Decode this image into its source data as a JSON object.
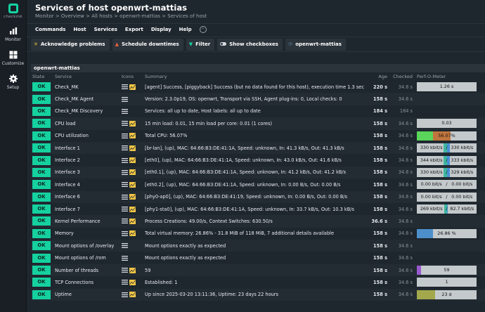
{
  "app": {
    "logo_text": "checkmk"
  },
  "sidebar": {
    "items": [
      {
        "label": "Monitor",
        "icon": "monitor-icon"
      },
      {
        "label": "Customize",
        "icon": "customize-icon"
      },
      {
        "label": "Setup",
        "icon": "setup-icon"
      }
    ]
  },
  "header": {
    "title": "Services of host openwrt-mattias",
    "breadcrumb": "Monitor > Overview > All hosts > openwrt-mattias > Services of host"
  },
  "menubar": {
    "items": [
      "Commands",
      "Host",
      "Services",
      "Export",
      "Display",
      "Help"
    ]
  },
  "toolbar": {
    "acknowledge": "Acknowledge problems",
    "downtimes": "Schedule downtimes",
    "filter": "Filter",
    "checkboxes": "Show checkboxes",
    "host": "openwrt-mattias"
  },
  "table": {
    "title": "openwrt-mattias",
    "columns": {
      "state": "State",
      "service": "Service",
      "icons": "Icons",
      "summary": "Summary",
      "age": "Age",
      "checked": "Checked",
      "perf": "Perf-O-Meter"
    },
    "rows": [
      {
        "state": "OK",
        "service": "Check_MK",
        "summary": "[agent] Success, [piggyback] Success (but no data found for this host), execution time 1.3 sec",
        "age": "220 s",
        "checked": "34.6 s",
        "graph": true,
        "perf": {
          "text": "1.26 s",
          "fill": 0
        }
      },
      {
        "state": "OK",
        "service": "Check_MK Agent",
        "summary": "Version: 2.3.0p19, OS: openwrt, Transport via SSH, Agent plug-ins: 0, Local checks: 0",
        "age": "158 s",
        "checked": "34.6 s",
        "graph": false,
        "perf": null
      },
      {
        "state": "OK",
        "service": "Check_MK Discovery",
        "summary": "Services: all up to date, Host labels: all up to date",
        "age": "184 s",
        "checked": "184 s",
        "graph": false,
        "perf": null
      },
      {
        "state": "OK",
        "service": "CPU load",
        "summary": "15 min load: 0.01, 15 min load per core: 0.01 (1 cores)",
        "age": "158 s",
        "checked": "34.6 s",
        "graph": true,
        "perf": {
          "text": "0.03",
          "fill": 0
        }
      },
      {
        "state": "OK",
        "service": "CPU utilization",
        "summary": "Total CPU: 56.07%",
        "age": "158 s",
        "checked": "34.6 s",
        "graph": true,
        "perf": {
          "text": "56.07%",
          "segments": [
            {
              "frac": 0.27,
              "color": "#5ad45a"
            },
            {
              "frac": 0.29,
              "color": "#c0753d"
            }
          ]
        }
      },
      {
        "state": "OK",
        "service": "Interface 1",
        "summary": "[br-lan], (up), MAC: 64:66:B3:DE:41:1A, Speed: unknown, In: 41.3 kB/s, Out: 41.3 kB/s",
        "age": "158 s",
        "checked": "34.6 s",
        "graph": true,
        "perf": {
          "in": "330 kbit/s",
          "out": "330 kbit/s",
          "in_frac": 0.1,
          "out_frac": 0.1
        }
      },
      {
        "state": "OK",
        "service": "Interface 2",
        "summary": "[eth0], (up), MAC: 64:66:B3:DE:41:1A, Speed: unknown, In: 43.0 kB/s, Out: 41.6 kB/s",
        "age": "158 s",
        "checked": "34.6 s",
        "graph": true,
        "perf": {
          "in": "344 kbit/s",
          "out": "333 kbit/s",
          "in_frac": 0.1,
          "out_frac": 0.1
        }
      },
      {
        "state": "OK",
        "service": "Interface 3",
        "summary": "[eth0.1], (up), MAC: 64:66:B3:DE:41:1A, Speed: unknown, In: 41.2 kB/s, Out: 41.2 kB/s",
        "age": "158 s",
        "checked": "34.6 s",
        "graph": true,
        "perf": {
          "in": "330 kbit/s",
          "out": "329 kbit/s",
          "in_frac": 0.1,
          "out_frac": 0.1
        }
      },
      {
        "state": "OK",
        "service": "Interface 4",
        "summary": "[eth0.2], (up), MAC: 64:66:B3:DE:41:1A, Speed: unknown, In: 0.00 B/s, Out: 0.00 B/s",
        "age": "158 s",
        "checked": "34.6 s",
        "graph": true,
        "perf": {
          "in": "0.00 bit/s",
          "out": "0.00 bit/s",
          "in_frac": 0,
          "out_frac": 0
        }
      },
      {
        "state": "OK",
        "service": "Interface 6",
        "summary": "[phy0-ap0], (up), MAC: 64:66:B3:DE:41:19, Speed: unknown, In: 0.00 B/s, Out: 0.00 B/s",
        "age": "158 s",
        "checked": "34.6 s",
        "graph": true,
        "perf": {
          "in": "0.00 bit/s",
          "out": "0.00 bit/s",
          "in_frac": 0,
          "out_frac": 0
        }
      },
      {
        "state": "OK",
        "service": "Interface 7",
        "summary": "[phy1-sta0], (up), MAC: 64:66:B3:DE:41:1A, Speed: unknown, In: 33.7 kB/s, Out: 10.3 kB/s",
        "age": "158 s",
        "checked": "34.6 s",
        "graph": true,
        "perf": {
          "in": "269 kbit/s",
          "out": "82.7 kbit/s",
          "in_frac": 0.09,
          "out_frac": 0.04
        }
      },
      {
        "state": "OK",
        "service": "Kernel Performance",
        "summary": "Process Creations: 49.00/s, Context Switches: 630.50/s",
        "age": "36.6 s",
        "checked": "34.6 s",
        "graph": true,
        "perf": null
      },
      {
        "state": "OK",
        "service": "Memory",
        "summary": "Total virtual memory: 26.86% - 31.8 MiB of 118 MiB, 7 additional details available",
        "age": "158 s",
        "checked": "34.6 s",
        "graph": true,
        "perf": {
          "text": "26.86 %",
          "segments": [
            {
              "frac": 0.2686,
              "color": "#4d8fcb"
            }
          ]
        }
      },
      {
        "state": "OK",
        "service": "Mount options of /overlay",
        "summary": "Mount options exactly as expected",
        "age": "158 s",
        "checked": "34.6 s",
        "graph": false,
        "perf": null
      },
      {
        "state": "OK",
        "service": "Mount options of /rom",
        "summary": "Mount options exactly as expected",
        "age": "158 s",
        "checked": "34.6 s",
        "graph": false,
        "perf": null
      },
      {
        "state": "OK",
        "service": "Number of threads",
        "summary": "59",
        "age": "158 s",
        "checked": "34.6 s",
        "graph": true,
        "perf": {
          "text": "59",
          "segments": [
            {
              "frac": 0.07,
              "color": "#9b59d0"
            }
          ]
        }
      },
      {
        "state": "OK",
        "service": "TCP Connections",
        "summary": "Established: 1",
        "age": "158 s",
        "checked": "34.6 s",
        "graph": true,
        "perf": {
          "text": "1",
          "fill": 0
        }
      },
      {
        "state": "OK",
        "service": "Uptime",
        "summary": "Up since 2025-03-20 13:11:36, Uptime: 23 days 22 hours",
        "age": "158 s",
        "checked": "34.6 s",
        "graph": true,
        "perf": {
          "text": "23 d",
          "segments": [
            {
              "frac": 0.3,
              "color": "#a3a84c"
            }
          ]
        }
      }
    ]
  },
  "colors": {
    "ok": "#15d1a0",
    "accent": "#15d1a0",
    "background": "#1e262e"
  }
}
